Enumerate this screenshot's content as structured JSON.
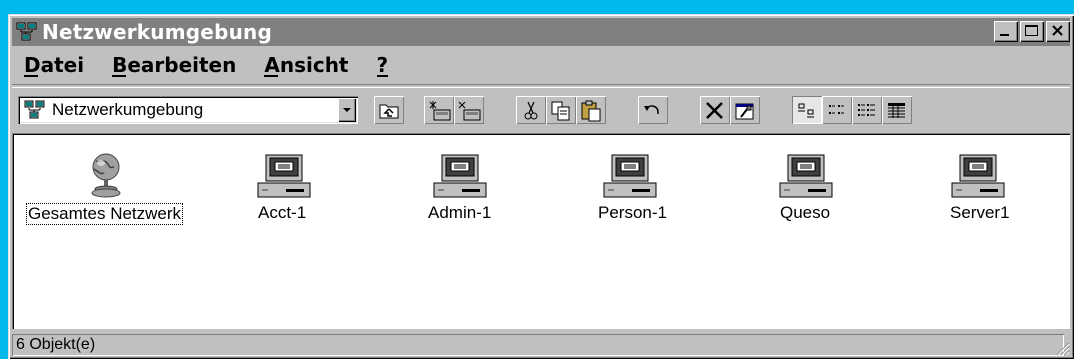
{
  "window": {
    "title": "Netzwerkumgebung",
    "controls": [
      "minimize",
      "maximize",
      "close"
    ]
  },
  "menu": {
    "items": [
      {
        "label": "Datei",
        "accel": "D"
      },
      {
        "label": "Bearbeiten",
        "accel": "B"
      },
      {
        "label": "Ansicht",
        "accel": "A"
      },
      {
        "label": "?",
        "accel": "?"
      }
    ]
  },
  "toolbar": {
    "address": "Netzwerkumgebung",
    "buttons": [
      "up-one-level-icon",
      "map-network-drive-icon",
      "disconnect-drive-icon",
      "cut-icon",
      "copy-icon",
      "paste-icon",
      "undo-icon",
      "delete-icon",
      "properties-icon",
      "large-icons-view-icon",
      "small-icons-view-icon",
      "list-view-icon",
      "details-view-icon"
    ],
    "active_view": "large-icons"
  },
  "items": [
    {
      "label": "Gesamtes Netzwerk",
      "icon": "globe-icon",
      "selected": true
    },
    {
      "label": "Acct-1",
      "icon": "computer-icon"
    },
    {
      "label": "Admin-1",
      "icon": "computer-icon"
    },
    {
      "label": "Person-1",
      "icon": "computer-icon"
    },
    {
      "label": "Queso",
      "icon": "computer-icon"
    },
    {
      "label": "Server1",
      "icon": "computer-icon"
    }
  ],
  "status": {
    "text": "6 Objekt(e)"
  },
  "colors": {
    "desktop": "#00b8ec",
    "titlebar_inactive": "#808080",
    "face": "#c0c0c0"
  }
}
